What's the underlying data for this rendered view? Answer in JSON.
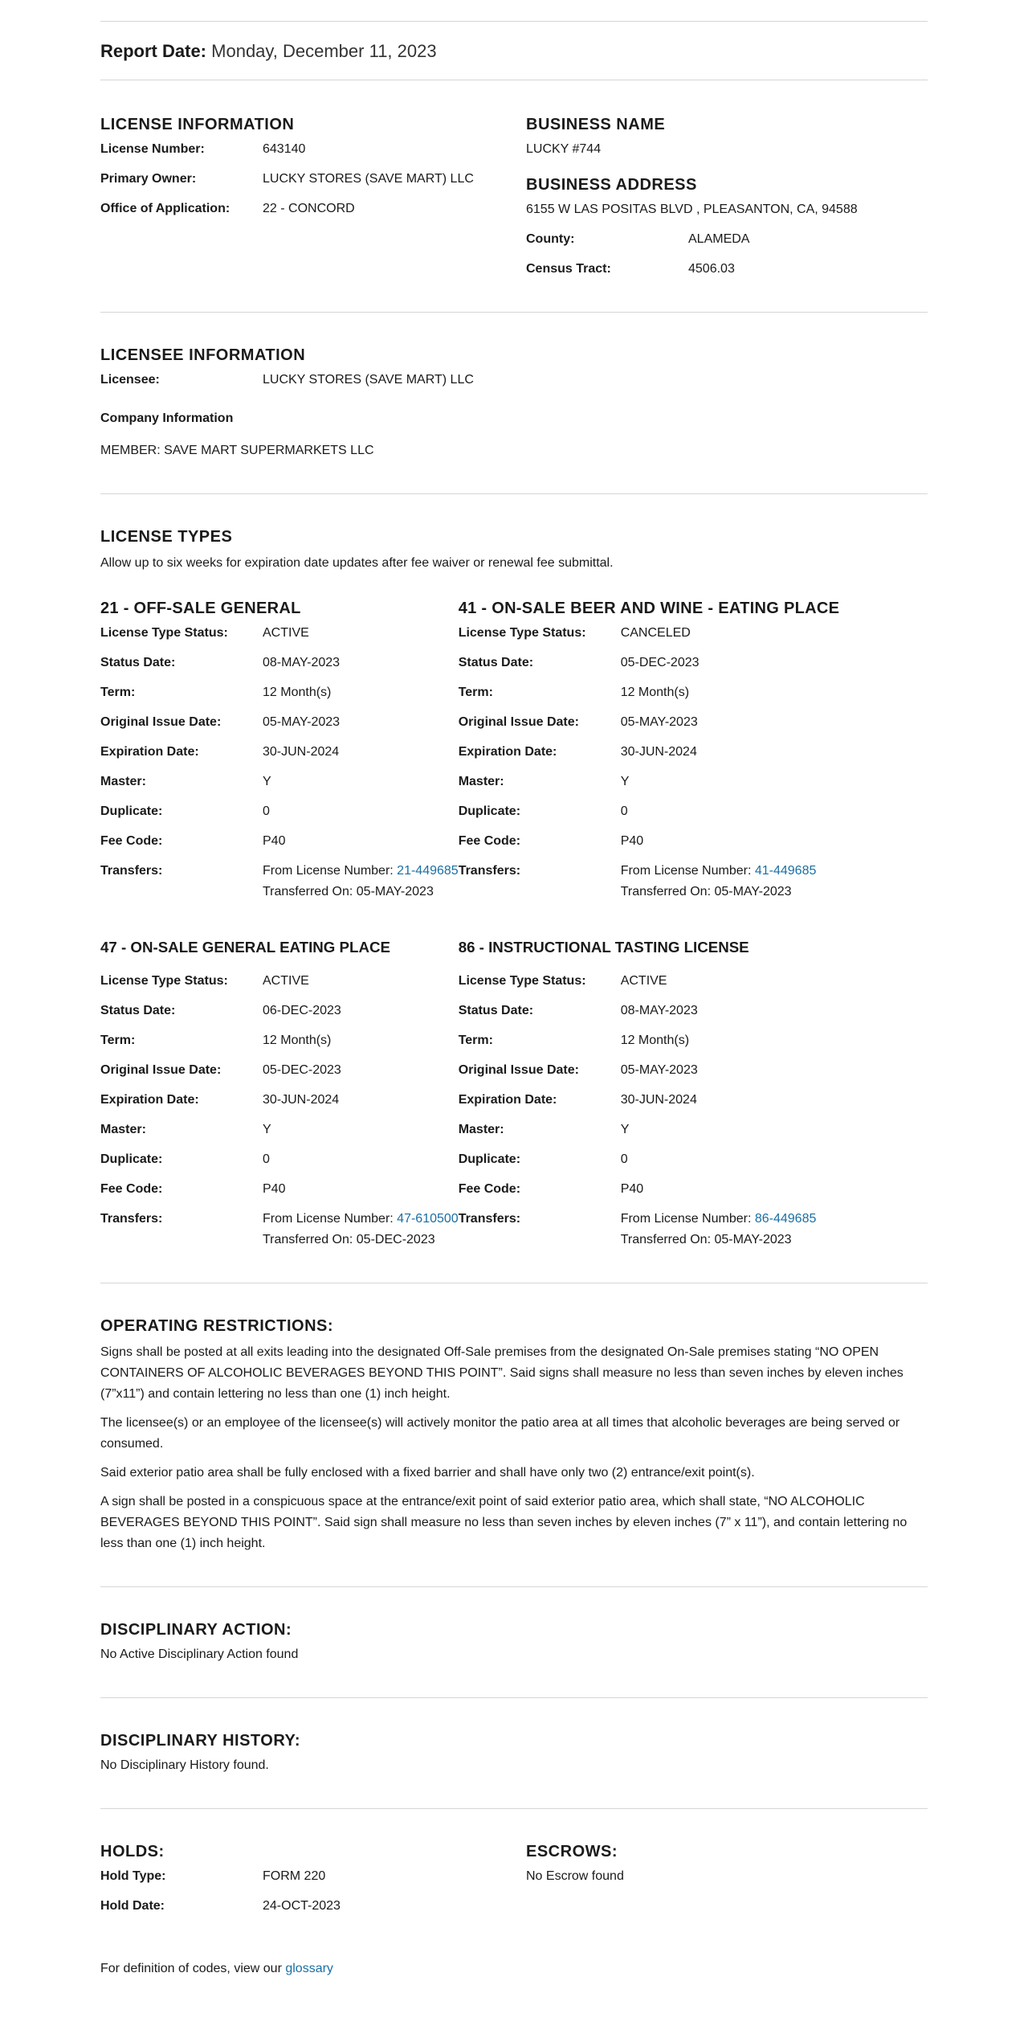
{
  "report": {
    "date_label": "Report Date:",
    "date_value": "Monday, December 11, 2023"
  },
  "license_info": {
    "title": "LICENSE INFORMATION",
    "rows": [
      {
        "k": "License Number:",
        "v": "643140"
      },
      {
        "k": "Primary Owner:",
        "v": "LUCKY STORES (SAVE MART) LLC"
      },
      {
        "k": "Office of Application:",
        "v": "22 - CONCORD"
      }
    ]
  },
  "business": {
    "name_title": "BUSINESS NAME",
    "name": "LUCKY #744",
    "address_title": "BUSINESS ADDRESS",
    "address": "6155 W LAS POSITAS BLVD , PLEASANTON, CA, 94588",
    "rows": [
      {
        "k": "County:",
        "v": "ALAMEDA"
      },
      {
        "k": "Census Tract:",
        "v": "4506.03"
      }
    ]
  },
  "licensee": {
    "title": "LICENSEE INFORMATION",
    "licensee_label": "Licensee:",
    "licensee_value": "LUCKY STORES (SAVE MART) LLC",
    "company_title": "Company Information",
    "company_value": "MEMBER: SAVE MART SUPERMARKETS LLC"
  },
  "license_types": {
    "title": "LICENSE TYPES",
    "note": "Allow up to six weeks for expiration date updates after fee waiver or renewal fee submittal.",
    "labels": {
      "status": "License Type Status:",
      "status_date": "Status Date:",
      "term": "Term:",
      "orig_issue": "Original Issue Date:",
      "expiration": "Expiration Date:",
      "master": "Master:",
      "duplicate": "Duplicate:",
      "fee_code": "Fee Code:",
      "transfers": "Transfers:",
      "from_prefix": "From License Number: ",
      "transferred_prefix": "Transferred On: "
    },
    "items": [
      {
        "title": "21 - OFF-SALE GENERAL",
        "status": "ACTIVE",
        "status_date": "08-MAY-2023",
        "term": "12 Month(s)",
        "orig_issue": "05-MAY-2023",
        "expiration": "30-JUN-2024",
        "master": "Y",
        "duplicate": "0",
        "fee_code": "P40",
        "from_license": "21-449685",
        "transferred_on": "05-MAY-2023"
      },
      {
        "title": "41 - ON-SALE BEER AND WINE - EATING PLACE",
        "status": "CANCELED",
        "status_date": "05-DEC-2023",
        "term": "12 Month(s)",
        "orig_issue": "05-MAY-2023",
        "expiration": "30-JUN-2024",
        "master": "Y",
        "duplicate": "0",
        "fee_code": "P40",
        "from_license": "41-449685",
        "transferred_on": "05-MAY-2023"
      },
      {
        "title": "47 - ON-SALE GENERAL EATING PLACE",
        "status": "ACTIVE",
        "status_date": "06-DEC-2023",
        "term": "12 Month(s)",
        "orig_issue": "05-DEC-2023",
        "expiration": "30-JUN-2024",
        "master": "Y",
        "duplicate": "0",
        "fee_code": "P40",
        "from_license": "47-610500",
        "transferred_on": "05-DEC-2023"
      },
      {
        "title": "86 - INSTRUCTIONAL TASTING LICENSE",
        "status": "ACTIVE",
        "status_date": "08-MAY-2023",
        "term": "12 Month(s)",
        "orig_issue": "05-MAY-2023",
        "expiration": "30-JUN-2024",
        "master": "Y",
        "duplicate": "0",
        "fee_code": "P40",
        "from_license": "86-449685",
        "transferred_on": "05-MAY-2023"
      }
    ]
  },
  "restrictions": {
    "title": "OPERATING RESTRICTIONS:",
    "paragraphs": [
      "Signs shall be posted at all exits leading into the designated Off-Sale premises from the designated On-Sale premises stating “NO OPEN CONTAINERS OF ALCOHOLIC BEVERAGES BEYOND THIS POINT”. Said signs shall measure no less than seven inches by eleven inches (7”x11”) and contain lettering no less than one (1) inch height.",
      "The licensee(s) or an employee of the licensee(s) will actively monitor the patio area at all times that alcoholic beverages are being served or consumed.",
      "Said exterior patio area shall be fully enclosed with a fixed barrier and shall have only two (2) entrance/exit point(s).",
      "A sign shall be posted in a conspicuous space at the entrance/exit point of said exterior patio area, which shall state, “NO ALCOHOLIC BEVERAGES BEYOND THIS POINT”. Said sign shall measure no less than seven inches by eleven inches (7” x 11”), and contain lettering no less than one (1) inch height."
    ]
  },
  "disciplinary_action": {
    "title": "DISCIPLINARY ACTION:",
    "value": "No Active Disciplinary Action found"
  },
  "disciplinary_history": {
    "title": "DISCIPLINARY HISTORY:",
    "value": "No Disciplinary History found."
  },
  "holds": {
    "title": "HOLDS:",
    "rows": [
      {
        "k": "Hold Type:",
        "v": "FORM 220"
      },
      {
        "k": "Hold Date:",
        "v": "24-OCT-2023"
      }
    ]
  },
  "escrows": {
    "title": "ESCROWS:",
    "value": "No Escrow found"
  },
  "footer": {
    "prefix": "For definition of codes, view our ",
    "link": "glossary"
  }
}
